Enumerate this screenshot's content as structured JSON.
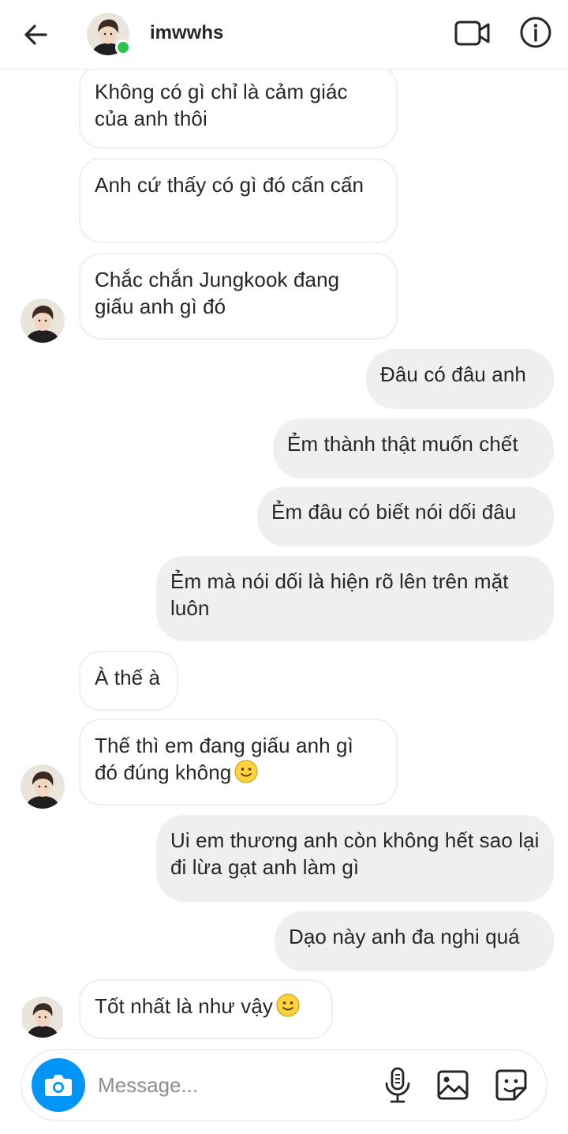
{
  "header": {
    "username": "imwwhs",
    "online": true
  },
  "messages": [
    {
      "side": "in",
      "text": "Không có gì chỉ là cảm giác của anh thôi"
    },
    {
      "side": "in",
      "text": "Anh cứ thấy có gì đó cấn cấn"
    },
    {
      "side": "in",
      "text": "Chắc chắn Jungkook đang giấu anh gì đó",
      "avatar": true
    },
    {
      "side": "out",
      "text": "Đâu có đâu anh"
    },
    {
      "side": "out",
      "text": "Ẻm thành thật muốn chết"
    },
    {
      "side": "out",
      "text": "Ẻm đâu có biết nói dối đâu"
    },
    {
      "side": "out",
      "text": "Ẻm mà nói dối là hiện rõ lên trên mặt luôn"
    },
    {
      "side": "in",
      "text": "À thế à"
    },
    {
      "side": "in",
      "text": "Thế thì em đang giấu anh gì đó đúng không",
      "emoji": "slight-smile-emoji",
      "avatar": true
    },
    {
      "side": "out",
      "text": "Ui em thương anh còn không hết sao lại đi lừa gạt anh làm gì"
    },
    {
      "side": "out",
      "text": "Dạo này anh đa nghi quá"
    },
    {
      "side": "in",
      "text": "Tốt nhất là như vậy",
      "emoji": "slight-smile-emoji",
      "avatar": true
    }
  ],
  "composer": {
    "placeholder": "Message..."
  },
  "icons": {
    "back": "arrow-left-icon",
    "video": "video-call-icon",
    "info": "info-icon",
    "camera": "camera-icon",
    "mic": "microphone-icon",
    "gallery": "image-gallery-icon",
    "sticker": "sticker-icon"
  },
  "colors": {
    "accent": "#0095f6",
    "online": "#2bc44c",
    "outgoing_bubble": "#efefef",
    "incoming_border": "#efefef"
  }
}
